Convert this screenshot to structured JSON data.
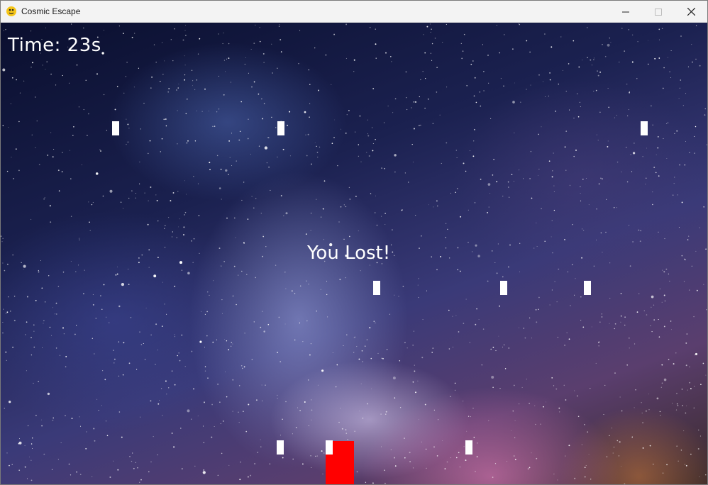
{
  "window": {
    "title": "Cosmic Escape",
    "icons": {
      "app": "pygame-snake-icon",
      "minimize": "minimize-icon",
      "maximize": "maximize-icon",
      "close": "close-icon"
    }
  },
  "hud": {
    "timer": "Time: 23s",
    "message": "You Lost!"
  },
  "colors": {
    "player": "#ff0000",
    "obstacle": "#ffffff",
    "hud_text": "#ffffff"
  }
}
